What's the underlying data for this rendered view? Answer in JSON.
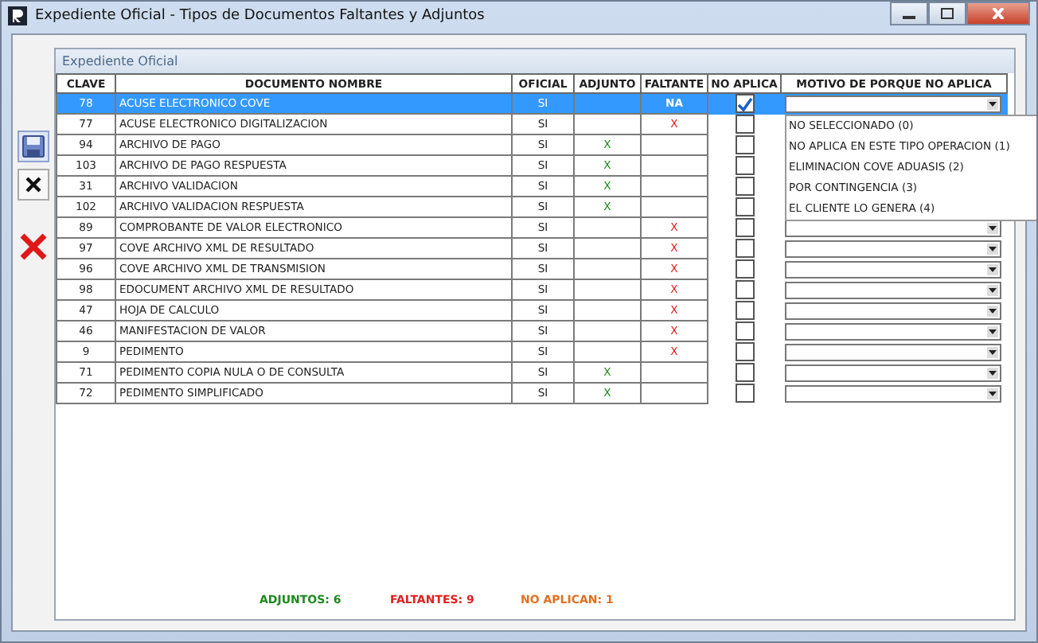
{
  "window": {
    "title": "Expediente Oficial - Tipos de Documentos Faltantes y Adjuntos"
  },
  "group": {
    "title": "Expediente Oficial"
  },
  "table": {
    "columns": [
      "CLAVE",
      "DOCUMENTO NOMBRE",
      "OFICIAL",
      "ADJUNTO",
      "FALTANTE",
      "NO APLICA",
      "MOTIVO DE PORQUE NO APLICA"
    ],
    "rows": [
      {
        "clave": "78",
        "documento": "ACUSE ELECTRONICO COVE",
        "oficial": "SI",
        "adjunto": "",
        "faltante": "NA",
        "no_aplica": true,
        "selected": true
      },
      {
        "clave": "77",
        "documento": "ACUSE ELECTRONICO DIGITALIZACION",
        "oficial": "SI",
        "adjunto": "",
        "faltante": "X",
        "no_aplica": false,
        "selected": false
      },
      {
        "clave": "94",
        "documento": "ARCHIVO DE PAGO",
        "oficial": "SI",
        "adjunto": "X",
        "faltante": "",
        "no_aplica": false,
        "selected": false
      },
      {
        "clave": "103",
        "documento": "ARCHIVO DE PAGO RESPUESTA",
        "oficial": "SI",
        "adjunto": "X",
        "faltante": "",
        "no_aplica": false,
        "selected": false
      },
      {
        "clave": "31",
        "documento": "ARCHIVO VALIDACION",
        "oficial": "SI",
        "adjunto": "X",
        "faltante": "",
        "no_aplica": false,
        "selected": false
      },
      {
        "clave": "102",
        "documento": "ARCHIVO VALIDACION RESPUESTA",
        "oficial": "SI",
        "adjunto": "X",
        "faltante": "",
        "no_aplica": false,
        "selected": false
      },
      {
        "clave": "89",
        "documento": "COMPROBANTE DE VALOR ELECTRONICO",
        "oficial": "SI",
        "adjunto": "",
        "faltante": "X",
        "no_aplica": false,
        "selected": false
      },
      {
        "clave": "97",
        "documento": "COVE ARCHIVO XML DE RESULTADO",
        "oficial": "SI",
        "adjunto": "",
        "faltante": "X",
        "no_aplica": false,
        "selected": false
      },
      {
        "clave": "96",
        "documento": "COVE ARCHIVO XML DE TRANSMISION",
        "oficial": "SI",
        "adjunto": "",
        "faltante": "X",
        "no_aplica": false,
        "selected": false
      },
      {
        "clave": "98",
        "documento": "EDOCUMENT ARCHIVO XML DE RESULTADO",
        "oficial": "SI",
        "adjunto": "",
        "faltante": "X",
        "no_aplica": false,
        "selected": false
      },
      {
        "clave": "47",
        "documento": "HOJA DE CALCULO",
        "oficial": "SI",
        "adjunto": "",
        "faltante": "X",
        "no_aplica": false,
        "selected": false
      },
      {
        "clave": "46",
        "documento": "MANIFESTACION DE VALOR",
        "oficial": "SI",
        "adjunto": "",
        "faltante": "X",
        "no_aplica": false,
        "selected": false
      },
      {
        "clave": "9",
        "documento": "PEDIMENTO",
        "oficial": "SI",
        "adjunto": "",
        "faltante": "X",
        "no_aplica": false,
        "selected": false
      },
      {
        "clave": "71",
        "documento": "PEDIMENTO COPIA NULA O DE CONSULTA",
        "oficial": "SI",
        "adjunto": "X",
        "faltante": "",
        "no_aplica": false,
        "selected": false
      },
      {
        "clave": "72",
        "documento": "PEDIMENTO SIMPLIFICADO",
        "oficial": "SI",
        "adjunto": "X",
        "faltante": "",
        "no_aplica": false,
        "selected": false
      }
    ]
  },
  "dropdown": {
    "options": [
      {
        "label": "NO SELECCIONADO (0)",
        "selected": false
      },
      {
        "label": "NO APLICA EN ESTE TIPO OPERACION (1)",
        "selected": false
      },
      {
        "label": "ELIMINACION COVE ADUASIS (2)",
        "selected": false
      },
      {
        "label": "POR CONTINGENCIA (3)",
        "selected": false
      },
      {
        "label": "EL CLIENTE LO GENERA (4)",
        "selected": false
      }
    ]
  },
  "totals": {
    "adjuntos": "ADJUNTOS: 6",
    "faltantes": "FALTANTES: 9",
    "no_aplican": "NO APLICAN: 1"
  }
}
